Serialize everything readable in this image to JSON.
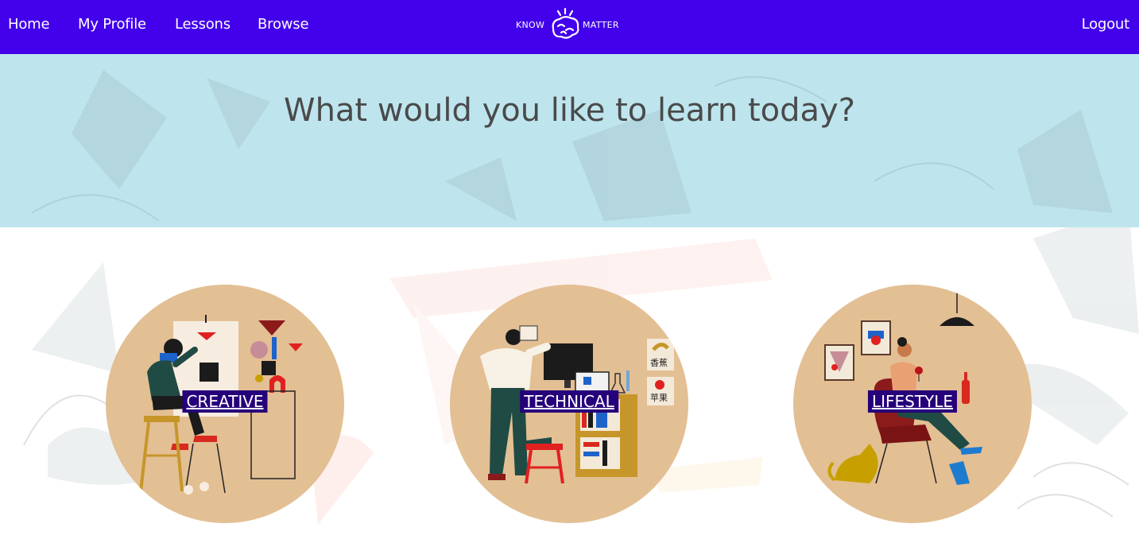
{
  "nav": {
    "home": "Home",
    "profile": "My Profile",
    "lessons": "Lessons",
    "browse": "Browse",
    "logout": "Logout"
  },
  "logo": {
    "left_text": "KNOW",
    "right_text": "MATTER",
    "icon": "brain-icon"
  },
  "hero": {
    "title": "What would you like to learn today?"
  },
  "categories": [
    {
      "label": "CREATIVE",
      "illustration": "artist-painting-illustration"
    },
    {
      "label": "TECHNICAL",
      "illustration": "person-reading-at-computer-illustration"
    },
    {
      "label": "LIFESTYLE",
      "illustration": "woman-with-wine-illustration"
    }
  ],
  "colors": {
    "nav_bg": "#4200eb",
    "hero_bg": "#bee5ee",
    "circle_bg": "#e3bf94",
    "label_bg": "#26007a"
  }
}
